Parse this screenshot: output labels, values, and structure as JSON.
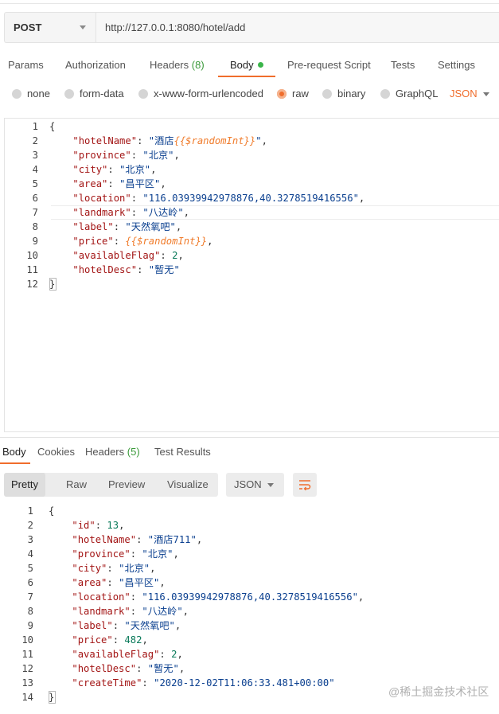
{
  "request": {
    "method": "POST",
    "url": "http://127.0.0.1:8080/hotel/add"
  },
  "request_tabs": {
    "params": "Params",
    "authorization": "Authorization",
    "headers": "Headers",
    "headers_count": "(8)",
    "body": "Body",
    "prerequest": "Pre-request Script",
    "tests": "Tests",
    "settings": "Settings"
  },
  "body_types": {
    "none": "none",
    "form_data": "form-data",
    "urlencoded": "x-www-form-urlencoded",
    "raw": "raw",
    "binary": "binary",
    "graphql": "GraphQL",
    "format": "JSON"
  },
  "request_body": {
    "line_numbers": [
      "1",
      "2",
      "3",
      "4",
      "5",
      "6",
      "7",
      "8",
      "9",
      "10",
      "11",
      "12"
    ],
    "open": "{",
    "close": "}",
    "hotelName_key": "\"hotelName\"",
    "hotelName_prefix": "\"酒店",
    "hotelName_var": "{{$randomInt}}",
    "hotelName_suffix": "\"",
    "province_key": "\"province\"",
    "province_val": "\"北京\"",
    "city_key": "\"city\"",
    "city_val": "\"北京\"",
    "area_key": "\"area\"",
    "area_val": "\"昌平区\"",
    "location_key": "\"location\"",
    "location_val": "\"116.03939942978876,40.3278519416556\"",
    "landmark_key": "\"landmark\"",
    "landmark_val": "\"八达岭\"",
    "label_key": "\"label\"",
    "label_val": "\"天然氧吧\"",
    "price_key": "\"price\"",
    "price_var": "{{$randomInt}}",
    "availableFlag_key": "\"availableFlag\"",
    "availableFlag_val": "2",
    "hotelDesc_key": "\"hotelDesc\"",
    "hotelDesc_val": "\"暂无\""
  },
  "response_tabs": {
    "body": "Body",
    "cookies": "Cookies",
    "headers": "Headers",
    "headers_count": "(5)",
    "test_results": "Test Results"
  },
  "view_modes": {
    "pretty": "Pretty",
    "raw": "Raw",
    "preview": "Preview",
    "visualize": "Visualize",
    "format": "JSON"
  },
  "response_body": {
    "line_numbers": [
      "1",
      "2",
      "3",
      "4",
      "5",
      "6",
      "7",
      "8",
      "9",
      "10",
      "11",
      "12",
      "13",
      "14"
    ],
    "open": "{",
    "close": "}",
    "id_key": "\"id\"",
    "id_val": "13",
    "hotelName_key": "\"hotelName\"",
    "hotelName_val": "\"酒店711\"",
    "province_key": "\"province\"",
    "province_val": "\"北京\"",
    "city_key": "\"city\"",
    "city_val": "\"北京\"",
    "area_key": "\"area\"",
    "area_val": "\"昌平区\"",
    "location_key": "\"location\"",
    "location_val": "\"116.03939942978876,40.3278519416556\"",
    "landmark_key": "\"landmark\"",
    "landmark_val": "\"八达岭\"",
    "label_key": "\"label\"",
    "label_val": "\"天然氧吧\"",
    "price_key": "\"price\"",
    "price_val": "482",
    "availableFlag_key": "\"availableFlag\"",
    "availableFlag_val": "2",
    "hotelDesc_key": "\"hotelDesc\"",
    "hotelDesc_val": "\"暂无\"",
    "createTime_key": "\"createTime\"",
    "createTime_val": "\"2020-12-02T11:06:33.481+00:00\""
  },
  "watermark": "@稀土掘金技术社区",
  "colors": {
    "accent": "#f06d2c",
    "green": "#3ab54a",
    "key": "#a31515",
    "string": "#0a3f8f",
    "number": "#0a7a5a",
    "variable": "#f07c2c"
  },
  "icons": {
    "method_dropdown": "chevron-down-icon",
    "body_dot": "status-dot-icon",
    "format_dropdown": "chevron-down-icon",
    "wrap": "wrap-lines-icon"
  }
}
